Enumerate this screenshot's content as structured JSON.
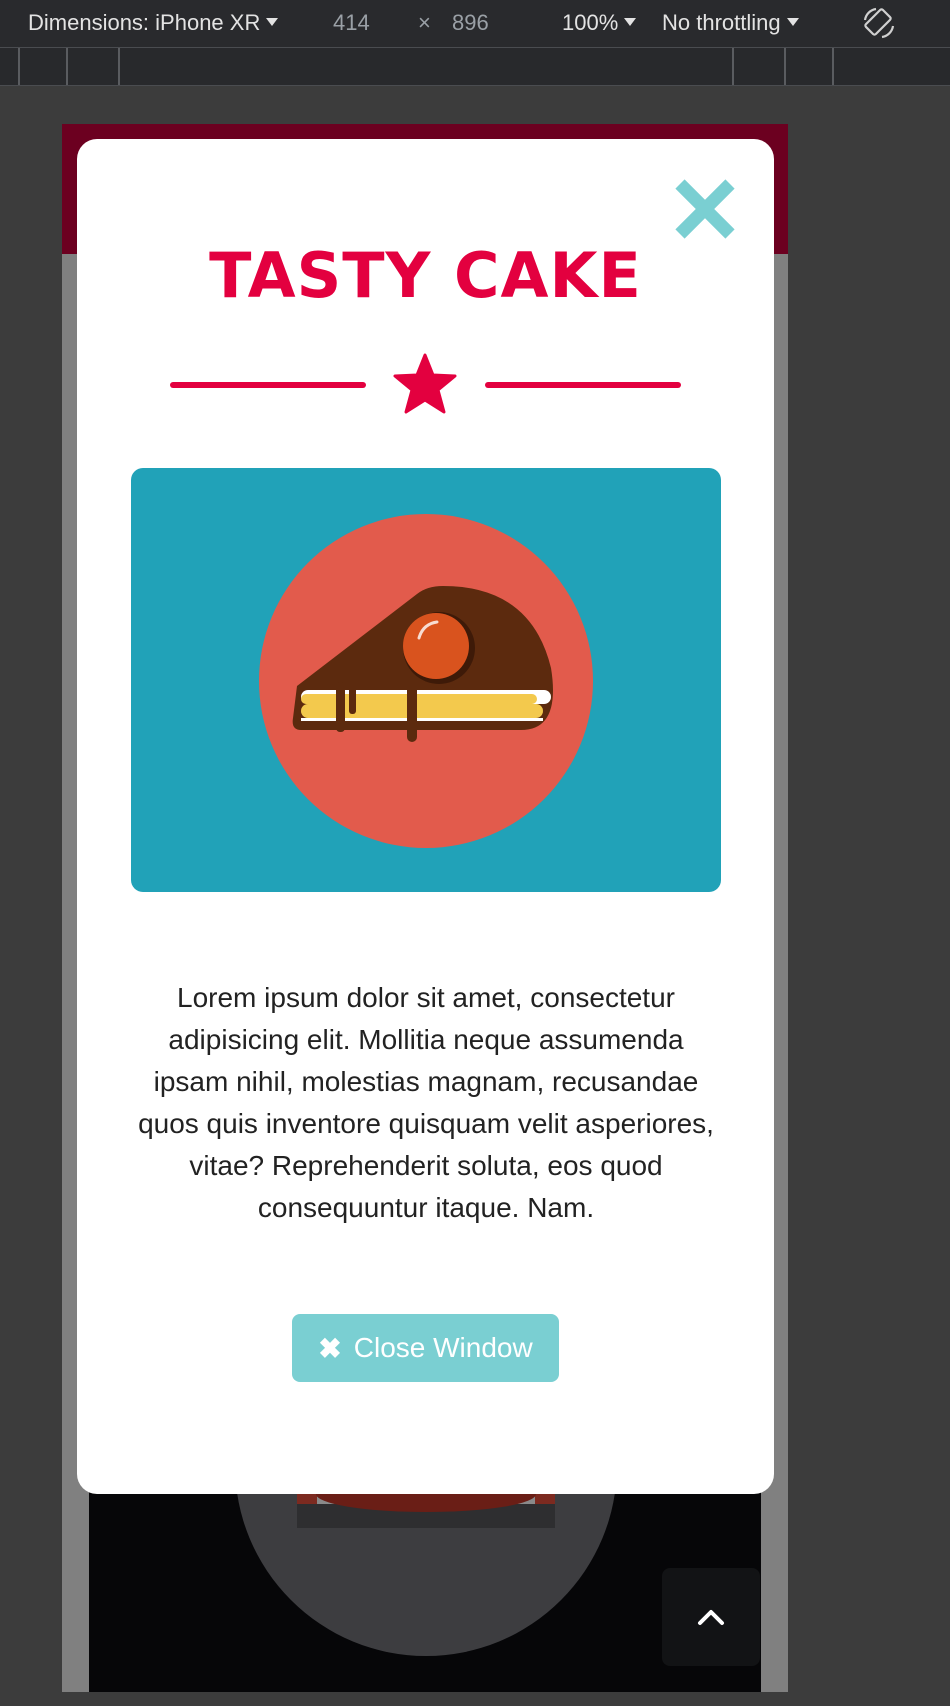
{
  "toolbar": {
    "dimensions_label": "Dimensions: iPhone XR",
    "width": "414",
    "times": "×",
    "height": "896",
    "zoom": "100%",
    "throttling": "No throttling",
    "rotate_icon": "rotate-icon"
  },
  "modal": {
    "title": "TASTY CAKE",
    "close_icon": "close-icon",
    "star_icon": "star-icon",
    "image": "cake-slice-illustration",
    "paragraph": "Lorem ipsum dolor sit amet, consectetur adipisicing elit. Mollitia neque assumenda ipsam nihil, molestias magnam, recusandae quos quis inventore quisquam velit asperiores, vitae? Reprehenderit soluta, eos quod consequuntur itaque. Nam.",
    "button_icon": "✖",
    "button_label": "Close Window"
  },
  "background": {
    "scroll_top_icon": "chevron-up-icon",
    "illustration": "circus-tent"
  },
  "colors": {
    "accent": "#e3003f",
    "teal": "#21a2b8",
    "button": "#7acfd2",
    "header": "#6c0020"
  }
}
